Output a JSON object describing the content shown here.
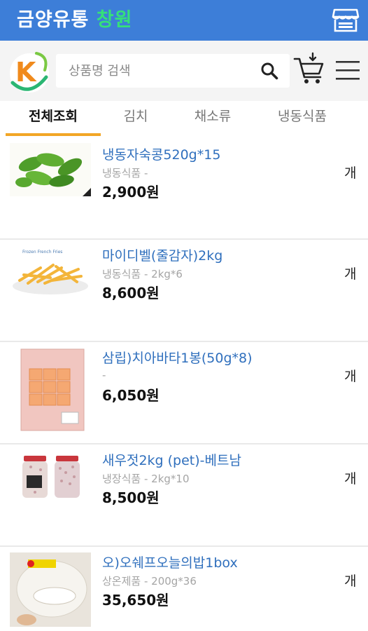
{
  "header": {
    "title_main": "금양유통",
    "title_highlight": "창원"
  },
  "search": {
    "placeholder": "상품명 검색"
  },
  "tabs": [
    {
      "label": "전체조회",
      "active": true
    },
    {
      "label": "김치",
      "active": false
    },
    {
      "label": "채소류",
      "active": false
    },
    {
      "label": "냉동식품",
      "active": false
    }
  ],
  "products": [
    {
      "name": "냉동자숙콩520g*15",
      "category_spec": "냉동식품 -",
      "price": "2,900원",
      "unit": "개"
    },
    {
      "name": "마이디벨(줄감자)2kg",
      "category_spec": "냉동식품 - 2kg*6",
      "price": "8,600원",
      "unit": "개"
    },
    {
      "name": "삼립)치아바타1봉(50g*8)",
      "category_spec": "-",
      "price": "6,050원",
      "unit": "개"
    },
    {
      "name": "새우젓2kg (pet)-베트남",
      "category_spec": "냉장식품 - 2kg*10",
      "price": "8,500원",
      "unit": "개"
    },
    {
      "name": "오)오쉐프오늘의밥1box",
      "category_spec": "상온제품 - 200g*36",
      "price": "35,650원",
      "unit": "개"
    }
  ],
  "colors": {
    "header_bg": "#3d7ed8",
    "highlight": "#35e07a",
    "tab_indicator": "#f2a626",
    "product_name": "#2f6fbd"
  }
}
